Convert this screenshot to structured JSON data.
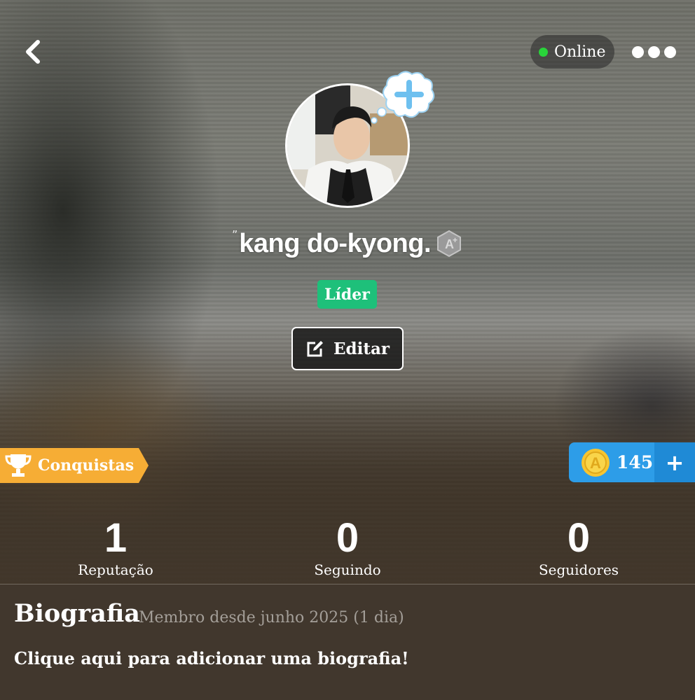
{
  "header": {
    "status_label": "Online",
    "status_color": "#29d33a",
    "back_icon": "chevron-left-icon",
    "more_icon": "more-dots-icon"
  },
  "profile": {
    "name_prefix": "ˮ",
    "name": "kang do-kyong.",
    "level_badge_icon": "amino-plus-badge-icon",
    "role": "Líder",
    "role_color": "#1ec07a",
    "edit_label": "Editar",
    "add_status_icon": "plus-bubble-icon"
  },
  "achievements": {
    "label": "Conquistas",
    "color": "#f6ad35"
  },
  "coins": {
    "value": "145",
    "plus": "+",
    "color": "#2d9de8"
  },
  "stats": [
    {
      "value": "1",
      "label": "Reputação"
    },
    {
      "value": "0",
      "label": "Seguindo"
    },
    {
      "value": "0",
      "label": "Seguidores"
    }
  ],
  "bio": {
    "title": "Biografia",
    "member_since": "Membro desde junho 2025 (1 dia)",
    "cta": "Clique aqui para adicionar uma biografia!"
  }
}
